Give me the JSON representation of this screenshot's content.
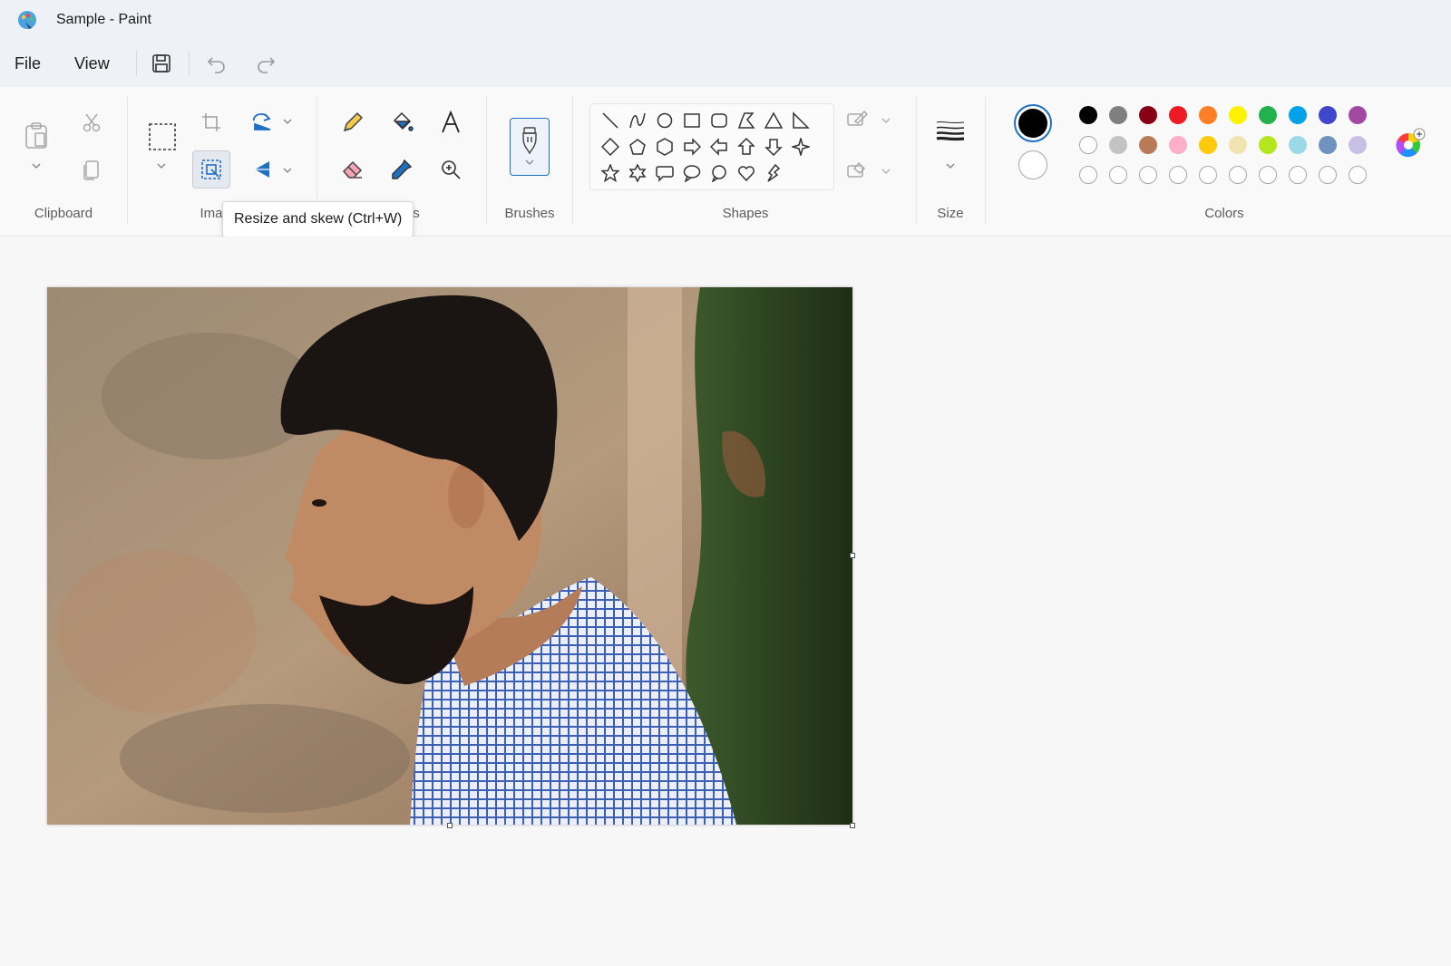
{
  "window": {
    "title": "Sample - Paint",
    "app_icon": "paint-palette-icon"
  },
  "menu": {
    "file": "File",
    "view": "View"
  },
  "quick_access": {
    "save": "save-icon",
    "undo": "undo-icon",
    "redo": "redo-icon"
  },
  "ribbon": {
    "groups": {
      "clipboard": "Clipboard",
      "image_partial": "Ima",
      "tools_partial": "s",
      "brushes": "Brushes",
      "shapes": "Shapes",
      "size": "Size",
      "colors": "Colors"
    },
    "tooltip": "Resize and skew (Ctrl+W)"
  },
  "colors": {
    "primary": "#000000",
    "secondary": "#ffffff",
    "palette_row1": [
      "#000000",
      "#7f7f7f",
      "#880015",
      "#ed1c24",
      "#ff7f27",
      "#fff200",
      "#22b14c",
      "#00a2e8",
      "#3f48cc",
      "#a349a4"
    ],
    "palette_row2": [
      "#ffffff",
      "#c3c3c3",
      "#b97a57",
      "#ffaec9",
      "#ffc90e",
      "#efe4b0",
      "#b5e61d",
      "#99d9ea",
      "#7092be",
      "#c8bfe7"
    ],
    "palette_row3_empty_count": 10,
    "accent": "#1f6fc3"
  }
}
